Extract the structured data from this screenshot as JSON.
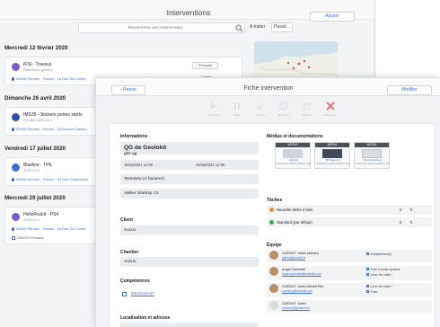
{
  "list": {
    "title": "Interventions",
    "add_label": "Ajouter",
    "search_placeholder": "Rechercher une intervention",
    "filter_todo": "A traiter",
    "filter_past": "Passé...",
    "groups": [
      {
        "day": "Mercredi 12 février 2020",
        "title": "IFSI - Travaux",
        "sub": "Référence (pince)",
        "address": "50000 Rennes - France - 18 Rue Du Corbin",
        "status": "En cours",
        "flag": "Urgent"
      },
      {
        "day": "Dimanche 26 avril 2020",
        "title": "IMS35 - Stickers portes starts",
        "sub": "FH ville 2020-04-1",
        "address": "50000 Rennes - France - 18 Avenue Gaston",
        "status": "",
        "flag": ""
      },
      {
        "day": "Vendredi 17 juillet 2020",
        "title": "Blueline - TPE",
        "sub": "2020-07-1",
        "address": "50000 Rennes - France - 54 Rue Chardonnet",
        "status": "",
        "flag": ""
      },
      {
        "day": "Mercredi 29 juillet 2020",
        "title": "HelloRocklt - PS4",
        "sub": "2020-07-1",
        "address": "50000 Rennes - France - 18 Rue Du Corbin",
        "extra": "CACES Fenwick",
        "status": "",
        "flag": ""
      }
    ]
  },
  "fiche": {
    "title": "Fiche intervention",
    "back_label": "Retour",
    "edit_label": "Modifier",
    "actions": [
      {
        "label": "Démarrer",
        "icon": "play-icon",
        "color": "#d9dcdf"
      },
      {
        "label": "Pause",
        "icon": "pause-icon",
        "color": "#d9dcdf"
      },
      {
        "label": "Terminer",
        "icon": "check-icon",
        "color": "#d9dcdf"
      },
      {
        "label": "Dupliquer",
        "icon": "duplicate-icon",
        "color": "#d9dcdf"
      },
      {
        "label": "Archiver",
        "icon": "archive-icon",
        "color": "#d9dcdf"
      },
      {
        "label": "Supprimer",
        "icon": "delete-icon",
        "color": "#e36b6b"
      }
    ],
    "informations_label": "Informations",
    "info_title": "QG de Geolokit",
    "info_ref": "gkit-qg",
    "date_start": "18/11/2021 11:00",
    "date_end": "18/11/2021 12:00",
    "info_status": "Terminée (A facturer)",
    "info_workshop": "Atelier StartUp <3",
    "client_label": "Client",
    "client_value": "Aucun",
    "chantier_label": "Chantier",
    "chantier_value": "Aucun",
    "competences_label": "Compétences",
    "competence_link": "Electricité BT",
    "localisation_label": "Localisation et adresse",
    "media_label": "Médias et documentations",
    "media": [
      {
        "head": "MÉDIA",
        "name": "mémoire",
        "meta": "10/02/2021 09h40 CUÉNOT Julien"
      },
      {
        "head": "MÉDIA",
        "name": "BKT logo com",
        "meta": "10/02/2021 11h00 CUÉNOT Julien"
      },
      {
        "head": "MÉDIA",
        "name": "Docs ShowHome",
        "meta": "10/02/2021 11h00 CUÉNOT Julien"
      }
    ],
    "taches_label": "Tâches",
    "tasks": [
      {
        "label": "Nouvelle tâche à faire",
        "count": "0",
        "unit": "h",
        "color": "#f08c2e"
      },
      {
        "label": "Standard (par défaut)",
        "count": "0",
        "unit": "h",
        "color": "#3faa4a"
      }
    ],
    "equipe_label": "Équipe",
    "team": [
      {
        "name": "CUÉNOT Julien (admin)",
        "email": "julien@geolokit.fr",
        "roles": [
          "Entrepreneur(e)"
        ]
      },
      {
        "name": "Auger Gwenaël",
        "email": "auger.gwenael@hotmail.com",
        "roles": [
          "Pose à boule dynceve",
          "Lever de roulle !"
        ]
      },
      {
        "name": "CUÉNOT Julien Michel Elio",
        "email": "cuenot.j@hotmail.com",
        "roles": [
          "Lever de roulle !",
          "Pose"
        ]
      },
      {
        "name": "CUÉNOT Julien",
        "email": "cuenot.j@gmail.com",
        "roles": []
      }
    ]
  }
}
